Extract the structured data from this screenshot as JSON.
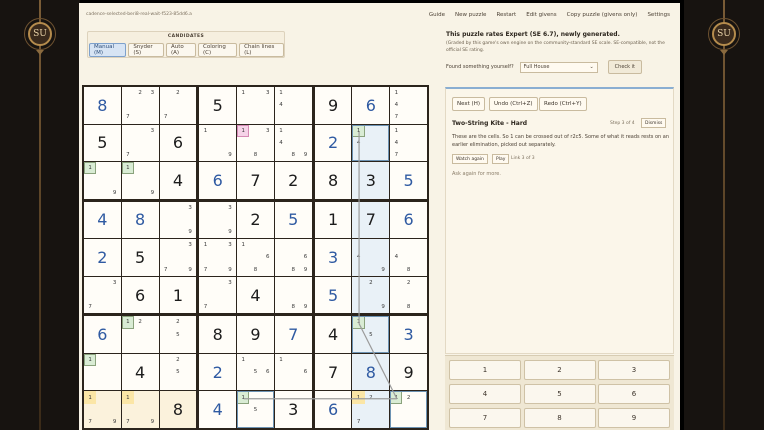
{
  "url": "cadence-selected-beri8-real-wait-f523-85dd6.a",
  "nav": [
    "Guide",
    "New puzzle",
    "Restart",
    "Edit givens",
    "Copy puzzle (givens only)",
    "Settings"
  ],
  "brand_left": "SU",
  "brand_right": "SU",
  "candidates": {
    "heading": "CANDIDATES",
    "modes": [
      "Manual (M)",
      "Snyder (S)",
      "Auto (A)",
      "Coloring (C)",
      "Chain lines (L)"
    ],
    "active": 0
  },
  "rating": {
    "title": "This puzzle rates Expert (SE 6.7), newly generated.",
    "desc": "(Graded by this game's own engine on the community-standard SE scale. SE-compatible, not the official SE rating."
  },
  "found": {
    "label": "Found something yourself?",
    "value": "Full House",
    "check": "Check it"
  },
  "hint": {
    "next": "Next (H)",
    "undo": "Undo (Ctrl+Z)",
    "redo": "Redo (Ctrl+Y)",
    "title": "Two-String Kite - Hard",
    "step": "Step 3 of 4",
    "dismiss": "Dismiss",
    "text": "These are the cells. So 1 can be crossed out of r2c5. Some of what it reads rests on an earlier elimination, picked out separately.",
    "watch": "Watch again",
    "play": "Play",
    "link": "Link 3 of 3",
    "ask": "Ask again for more."
  },
  "pad": [
    "1",
    "2",
    "3",
    "4",
    "5",
    "6",
    "7",
    "8",
    "9"
  ],
  "grid": [
    [
      {
        "v": "8",
        "s": 1
      },
      {
        "c": {
          "2": "2",
          "3": "3",
          "7": "7"
        }
      },
      {
        "c": {
          "2": "2",
          "7": "7"
        }
      },
      {
        "v": "5"
      },
      {
        "c": {
          "1": "1",
          "3": "3"
        }
      },
      {
        "c": {
          "1": "1",
          "4": "4"
        }
      },
      {
        "v": "9"
      },
      {
        "v": "6",
        "s": 1
      },
      {
        "c": {
          "1": "1",
          "4": "4",
          "7": "7"
        }
      }
    ],
    [
      {
        "v": "5"
      },
      {
        "c": {
          "3": "3",
          "7": "7"
        }
      },
      {
        "v": "6"
      },
      {
        "c": {
          "1": "1",
          "9": "9"
        }
      },
      {
        "c": {
          "1": "1",
          "3": "3",
          "8": "8"
        },
        "hl": {
          "1": "pink"
        }
      },
      {
        "c": {
          "1": "1",
          "4": "4",
          "8": "8",
          "9": "9"
        }
      },
      {
        "v": "2",
        "s": 1
      },
      {
        "c": {
          "1": "1",
          "4": "4"
        },
        "hl": {
          "1": "green"
        }
      },
      {
        "c": {
          "1": "1",
          "4": "4",
          "7": "7"
        }
      }
    ],
    [
      {
        "c": {
          "1": "1",
          "9": "9"
        },
        "hl": {
          "1": "green"
        }
      },
      {
        "c": {
          "1": "1",
          "9": "9"
        },
        "hl": {
          "1": "green"
        }
      },
      {
        "v": "4"
      },
      {
        "v": "6",
        "s": 1
      },
      {
        "v": "7"
      },
      {
        "v": "2"
      },
      {
        "v": "8"
      },
      {
        "v": "3"
      },
      {
        "v": "5",
        "s": 1
      }
    ],
    [
      {
        "v": "4",
        "s": 1
      },
      {
        "v": "8",
        "s": 1
      },
      {
        "c": {
          "3": "3",
          "9": "9"
        }
      },
      {
        "c": {
          "3": "3",
          "9": "9"
        }
      },
      {
        "v": "2"
      },
      {
        "v": "5",
        "s": 1
      },
      {
        "v": "1"
      },
      {
        "v": "7"
      },
      {
        "v": "6",
        "s": 1
      }
    ],
    [
      {
        "v": "2",
        "s": 1
      },
      {
        "v": "5"
      },
      {
        "c": {
          "3": "3",
          "7": "7",
          "9": "9"
        }
      },
      {
        "c": {
          "1": "1",
          "3": "3",
          "7": "7",
          "9": "9"
        }
      },
      {
        "c": {
          "1": "1",
          "6": "6",
          "8": "8"
        }
      },
      {
        "c": {
          "6": "6",
          "8": "8",
          "9": "9"
        }
      },
      {
        "v": "3",
        "s": 1
      },
      {
        "c": {
          "4": "4",
          "9": "9"
        }
      },
      {
        "c": {
          "4": "4",
          "8": "8"
        }
      }
    ],
    [
      {
        "c": {
          "3": "3",
          "7": "7"
        }
      },
      {
        "v": "6"
      },
      {
        "v": "1"
      },
      {
        "c": {
          "3": "3",
          "7": "7"
        }
      },
      {
        "v": "4"
      },
      {
        "c": {
          "8": "8",
          "9": "9"
        }
      },
      {
        "v": "5",
        "s": 1
      },
      {
        "c": {
          "2": "2",
          "9": "9"
        }
      },
      {
        "c": {
          "2": "2",
          "8": "8"
        }
      }
    ],
    [
      {
        "v": "6",
        "s": 1
      },
      {
        "c": {
          "1": "1",
          "2": "2"
        },
        "hl": {
          "1": "green"
        }
      },
      {
        "c": {
          "2": "2",
          "5": "5"
        }
      },
      {
        "v": "8"
      },
      {
        "v": "9"
      },
      {
        "v": "7",
        "s": 1
      },
      {
        "v": "4"
      },
      {
        "c": {
          "1": "1",
          "5": "5"
        },
        "hl": {
          "1": "green"
        }
      },
      {
        "v": "3",
        "s": 1
      }
    ],
    [
      {
        "c": {
          "1": "1"
        },
        "hl": {
          "1": "green"
        }
      },
      {
        "v": "4"
      },
      {
        "c": {
          "2": "2",
          "5": "5"
        }
      },
      {
        "v": "2",
        "s": 1
      },
      {
        "c": {
          "1": "1",
          "5": "5",
          "6": "6"
        }
      },
      {
        "c": {
          "1": "1",
          "6": "6"
        }
      },
      {
        "v": "7"
      },
      {
        "v": "8",
        "s": 1
      },
      {
        "v": "9"
      }
    ],
    [
      {
        "c": {
          "1": "1",
          "7": "7",
          "9": "9"
        },
        "hl": {
          "1": "yellow"
        }
      },
      {
        "c": {
          "1": "1",
          "7": "7",
          "9": "9"
        },
        "hl": {
          "1": "yellow"
        }
      },
      {
        "v": "8"
      },
      {
        "v": "4",
        "s": 1
      },
      {
        "c": {
          "1": "1",
          "5": "5"
        },
        "hl": {
          "1": "green"
        }
      },
      {
        "v": "3"
      },
      {
        "v": "6",
        "s": 1
      },
      {
        "c": {
          "1": "1",
          "2": "2",
          "7": "7"
        },
        "hl": {
          "1": "yellow"
        }
      },
      {
        "c": {
          "1": "1",
          "2": "2"
        },
        "hl": {
          "1": "green"
        }
      }
    ]
  ]
}
